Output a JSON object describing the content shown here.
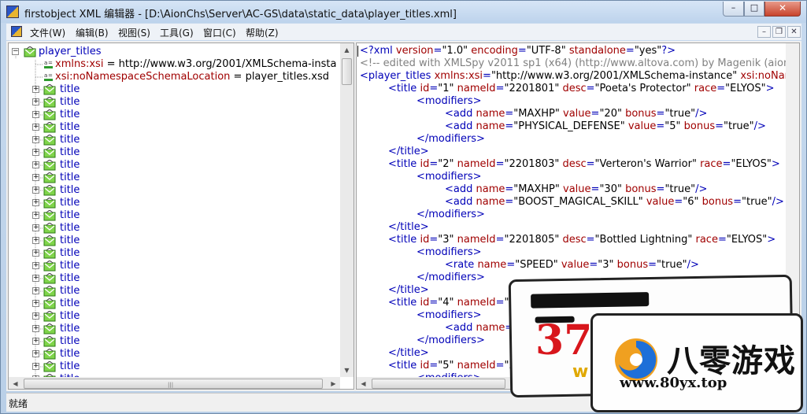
{
  "window": {
    "title": "firstobject XML 编辑器 - [D:\\AionChs\\Server\\AC-GS\\data\\static_data\\player_titles.xml]",
    "buttons": {
      "minimize": "–",
      "maximize": "□",
      "close": "✕"
    }
  },
  "menu": {
    "items": [
      "文件(W)",
      "编辑(B)",
      "视图(S)",
      "工具(G)",
      "窗口(C)",
      "帮助(Z)"
    ],
    "mdi_buttons": {
      "minimize": "–",
      "restore": "❐",
      "close": "✕"
    }
  },
  "tree": {
    "root": "player_titles",
    "attributes": [
      {
        "name": "xmlns:xsi",
        "sep": " = ",
        "value": "http://www.w3.org/2001/XMLSchema-insta"
      },
      {
        "name": "xsi:noNamespaceSchemaLocation",
        "sep": " = ",
        "value": "player_titles.xsd"
      }
    ],
    "children": [
      "title",
      "title",
      "title",
      "title",
      "title",
      "title",
      "title",
      "title",
      "title",
      "title",
      "title",
      "title",
      "title",
      "title",
      "title",
      "title",
      "title",
      "title",
      "title",
      "title",
      "title",
      "title",
      "title",
      "title"
    ]
  },
  "text_lines": [
    [
      [
        "pi",
        "<?xml "
      ],
      [
        "attr",
        "version"
      ],
      [
        "pi",
        "="
      ],
      [
        "val",
        "\"1.0\" "
      ],
      [
        "attr",
        "encoding"
      ],
      [
        "pi",
        "="
      ],
      [
        "val",
        "\"UTF-8\" "
      ],
      [
        "attr",
        "standalone"
      ],
      [
        "pi",
        "="
      ],
      [
        "val",
        "\"yes\""
      ],
      [
        "pi",
        "?>"
      ]
    ],
    [
      [
        "cmt",
        "<!-- edited with XMLSpy v2011 sp1 (x64) (http://www.altova.com) by Magenik (aion-e"
      ]
    ],
    [
      [
        "tag",
        "<player_titles "
      ],
      [
        "attr",
        "xmlns:xsi"
      ],
      [
        "tag",
        "="
      ],
      [
        "val",
        "\"http://www.w3.org/2001/XMLSchema-instance\" "
      ],
      [
        "attr",
        "xsi:noNam"
      ]
    ],
    [
      [
        "tag",
        "<title "
      ],
      [
        "attr",
        "id"
      ],
      [
        "tag",
        "="
      ],
      [
        "val",
        "\"1\" "
      ],
      [
        "attr",
        "nameId"
      ],
      [
        "tag",
        "="
      ],
      [
        "val",
        "\"2201801\" "
      ],
      [
        "attr",
        "desc"
      ],
      [
        "tag",
        "="
      ],
      [
        "val",
        "\"Poeta's Protector\" "
      ],
      [
        "attr",
        "race"
      ],
      [
        "tag",
        "="
      ],
      [
        "val",
        "\"ELYOS\""
      ],
      [
        "tag",
        ">"
      ]
    ],
    [
      [
        "tag",
        "<modifiers>"
      ]
    ],
    [
      [
        "tag",
        "<add "
      ],
      [
        "attr",
        "name"
      ],
      [
        "tag",
        "="
      ],
      [
        "val",
        "\"MAXHP\" "
      ],
      [
        "attr",
        "value"
      ],
      [
        "tag",
        "="
      ],
      [
        "val",
        "\"20\" "
      ],
      [
        "attr",
        "bonus"
      ],
      [
        "tag",
        "="
      ],
      [
        "val",
        "\"true\""
      ],
      [
        "tag",
        "/>"
      ]
    ],
    [
      [
        "tag",
        "<add "
      ],
      [
        "attr",
        "name"
      ],
      [
        "tag",
        "="
      ],
      [
        "val",
        "\"PHYSICAL_DEFENSE\" "
      ],
      [
        "attr",
        "value"
      ],
      [
        "tag",
        "="
      ],
      [
        "val",
        "\"5\" "
      ],
      [
        "attr",
        "bonus"
      ],
      [
        "tag",
        "="
      ],
      [
        "val",
        "\"true\""
      ],
      [
        "tag",
        "/>"
      ]
    ],
    [
      [
        "tag",
        "</modifiers>"
      ]
    ],
    [
      [
        "tag",
        "</title>"
      ]
    ],
    [
      [
        "tag",
        "<title "
      ],
      [
        "attr",
        "id"
      ],
      [
        "tag",
        "="
      ],
      [
        "val",
        "\"2\" "
      ],
      [
        "attr",
        "nameId"
      ],
      [
        "tag",
        "="
      ],
      [
        "val",
        "\"2201803\" "
      ],
      [
        "attr",
        "desc"
      ],
      [
        "tag",
        "="
      ],
      [
        "val",
        "\"Verteron's Warrior\" "
      ],
      [
        "attr",
        "race"
      ],
      [
        "tag",
        "="
      ],
      [
        "val",
        "\"ELYOS\""
      ],
      [
        "tag",
        ">"
      ]
    ],
    [
      [
        "tag",
        "<modifiers>"
      ]
    ],
    [
      [
        "tag",
        "<add "
      ],
      [
        "attr",
        "name"
      ],
      [
        "tag",
        "="
      ],
      [
        "val",
        "\"MAXHP\" "
      ],
      [
        "attr",
        "value"
      ],
      [
        "tag",
        "="
      ],
      [
        "val",
        "\"30\" "
      ],
      [
        "attr",
        "bonus"
      ],
      [
        "tag",
        "="
      ],
      [
        "val",
        "\"true\""
      ],
      [
        "tag",
        "/>"
      ]
    ],
    [
      [
        "tag",
        "<add "
      ],
      [
        "attr",
        "name"
      ],
      [
        "tag",
        "="
      ],
      [
        "val",
        "\"BOOST_MAGICAL_SKILL\" "
      ],
      [
        "attr",
        "value"
      ],
      [
        "tag",
        "="
      ],
      [
        "val",
        "\"6\" "
      ],
      [
        "attr",
        "bonus"
      ],
      [
        "tag",
        "="
      ],
      [
        "val",
        "\"true\""
      ],
      [
        "tag",
        "/>"
      ]
    ],
    [
      [
        "tag",
        "</modifiers>"
      ]
    ],
    [
      [
        "tag",
        "</title>"
      ]
    ],
    [
      [
        "tag",
        "<title "
      ],
      [
        "attr",
        "id"
      ],
      [
        "tag",
        "="
      ],
      [
        "val",
        "\"3\" "
      ],
      [
        "attr",
        "nameId"
      ],
      [
        "tag",
        "="
      ],
      [
        "val",
        "\"2201805\" "
      ],
      [
        "attr",
        "desc"
      ],
      [
        "tag",
        "="
      ],
      [
        "val",
        "\"Bottled Lightning\" "
      ],
      [
        "attr",
        "race"
      ],
      [
        "tag",
        "="
      ],
      [
        "val",
        "\"ELYOS\""
      ],
      [
        "tag",
        ">"
      ]
    ],
    [
      [
        "tag",
        "<modifiers>"
      ]
    ],
    [
      [
        "tag",
        "<rate "
      ],
      [
        "attr",
        "name"
      ],
      [
        "tag",
        "="
      ],
      [
        "val",
        "\"SPEED\" "
      ],
      [
        "attr",
        "value"
      ],
      [
        "tag",
        "="
      ],
      [
        "val",
        "\"3\" "
      ],
      [
        "attr",
        "bonus"
      ],
      [
        "tag",
        "="
      ],
      [
        "val",
        "\"true\""
      ],
      [
        "tag",
        "/>"
      ]
    ],
    [
      [
        "tag",
        "</modifiers>"
      ]
    ],
    [
      [
        "tag",
        "</title>"
      ]
    ],
    [
      [
        "tag",
        "<title "
      ],
      [
        "attr",
        "id"
      ],
      [
        "tag",
        "="
      ],
      [
        "val",
        "\"4\" "
      ],
      [
        "attr",
        "nameId"
      ],
      [
        "tag",
        "="
      ],
      [
        "val",
        "\"220"
      ]
    ],
    [
      [
        "tag",
        "<modifiers>"
      ]
    ],
    [
      [
        "tag",
        "<add "
      ],
      [
        "attr",
        "name"
      ],
      [
        "tag",
        "="
      ],
      [
        "val",
        "\"P"
      ]
    ],
    [
      [
        "tag",
        "</modifiers>"
      ]
    ],
    [
      [
        "tag",
        "</title>"
      ]
    ],
    [
      [
        "tag",
        "<title "
      ],
      [
        "attr",
        "id"
      ],
      [
        "tag",
        "="
      ],
      [
        "val",
        "\"5\" "
      ],
      [
        "attr",
        "nameId"
      ],
      [
        "tag",
        "="
      ],
      [
        "val",
        "\"220"
      ]
    ],
    [
      [
        "tag",
        "<modifiers>"
      ]
    ]
  ],
  "text_indent": [
    0,
    0,
    0,
    1,
    2,
    3,
    3,
    2,
    1,
    1,
    2,
    3,
    3,
    2,
    1,
    1,
    2,
    3,
    2,
    1,
    1,
    2,
    3,
    2,
    1,
    1,
    2
  ],
  "status": {
    "text": "就绪"
  },
  "watermark": {
    "number": "37",
    "w": "w",
    "brand": "八零游戏",
    "url": "www.80yx.top"
  }
}
